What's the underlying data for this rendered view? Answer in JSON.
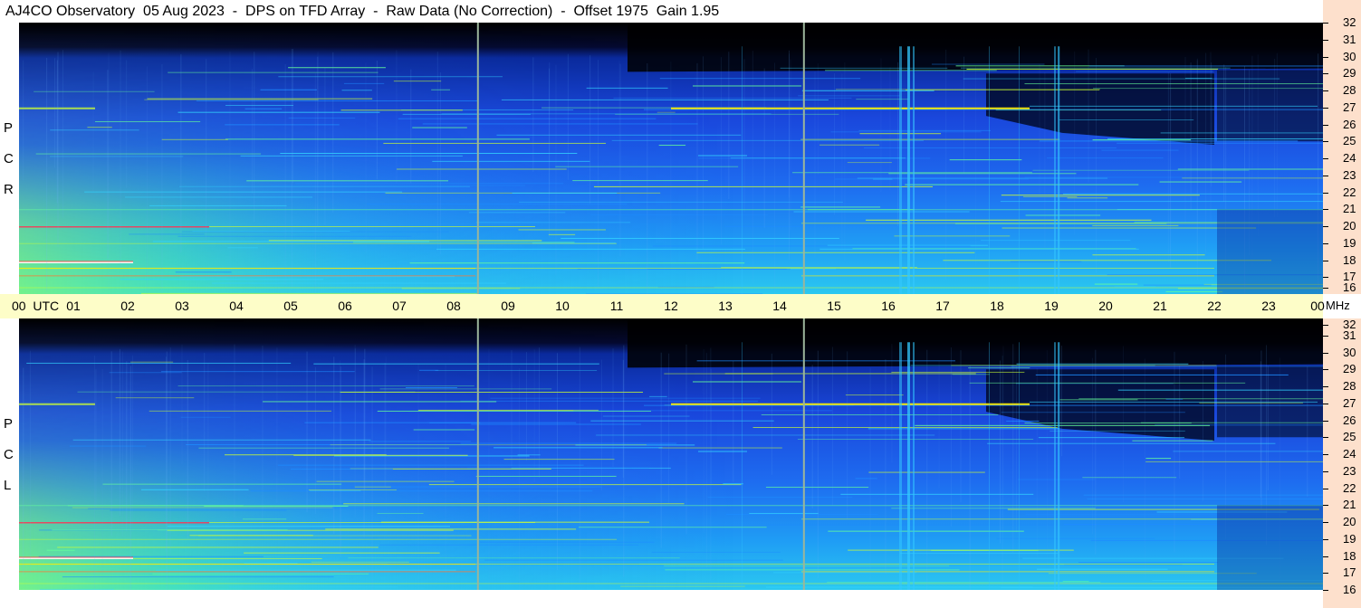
{
  "header": {
    "title": "AJ4CO Observatory  05 Aug 2023  -  DPS on TFD Array  -  Raw Data (No Correction)  -  Offset 1975  Gain 1.95"
  },
  "panels": [
    {
      "id": "rcp",
      "label_letters": [
        "P",
        "C",
        "R"
      ]
    },
    {
      "id": "lcp",
      "label_letters": [
        "P",
        "C",
        "L"
      ]
    }
  ],
  "time_axis": {
    "ticks": [
      "00",
      "01",
      "02",
      "03",
      "04",
      "05",
      "06",
      "07",
      "08",
      "09",
      "10",
      "11",
      "12",
      "13",
      "14",
      "15",
      "16",
      "17",
      "18",
      "19",
      "20",
      "21",
      "22",
      "23",
      "00"
    ],
    "unit_first": "UTC",
    "unit_last": "MHz"
  },
  "chart_data": {
    "type": "heatmap",
    "title": "AJ4CO Observatory  05 Aug 2023  -  DPS on TFD Array  -  Raw Data (No Correction)  -  Offset 1975  Gain 1.95",
    "x": {
      "label": "UTC",
      "range_hours": [
        0,
        24
      ],
      "tick_labels": [
        "00",
        "01",
        "02",
        "03",
        "04",
        "05",
        "06",
        "07",
        "08",
        "09",
        "10",
        "11",
        "12",
        "13",
        "14",
        "15",
        "16",
        "17",
        "18",
        "19",
        "20",
        "21",
        "22",
        "23",
        "00"
      ]
    },
    "y": {
      "label": "MHz",
      "range": [
        16,
        32
      ],
      "tick_labels": [
        "16",
        "17",
        "18",
        "19",
        "20",
        "21",
        "22",
        "23",
        "24",
        "25",
        "26",
        "27",
        "28",
        "29",
        "30",
        "31",
        "32"
      ]
    },
    "panels": [
      "RCP",
      "LCP"
    ],
    "colormap": [
      "#000000",
      "#0a1a8c",
      "#1a45e0",
      "#1e8cff",
      "#33d4ff",
      "#66ff99",
      "#ccff33",
      "#ffee00",
      "#ff7700",
      "#ff2222",
      "#ffffff"
    ],
    "gaps_utc": [
      8.43,
      14.43
    ],
    "bright_bands_mhz": [
      27.0,
      20.0,
      17.9,
      17.5,
      21.0
    ],
    "broadband_columns_utc": [
      16.35,
      19.1
    ],
    "gap_line_color": "#9bb59b"
  }
}
